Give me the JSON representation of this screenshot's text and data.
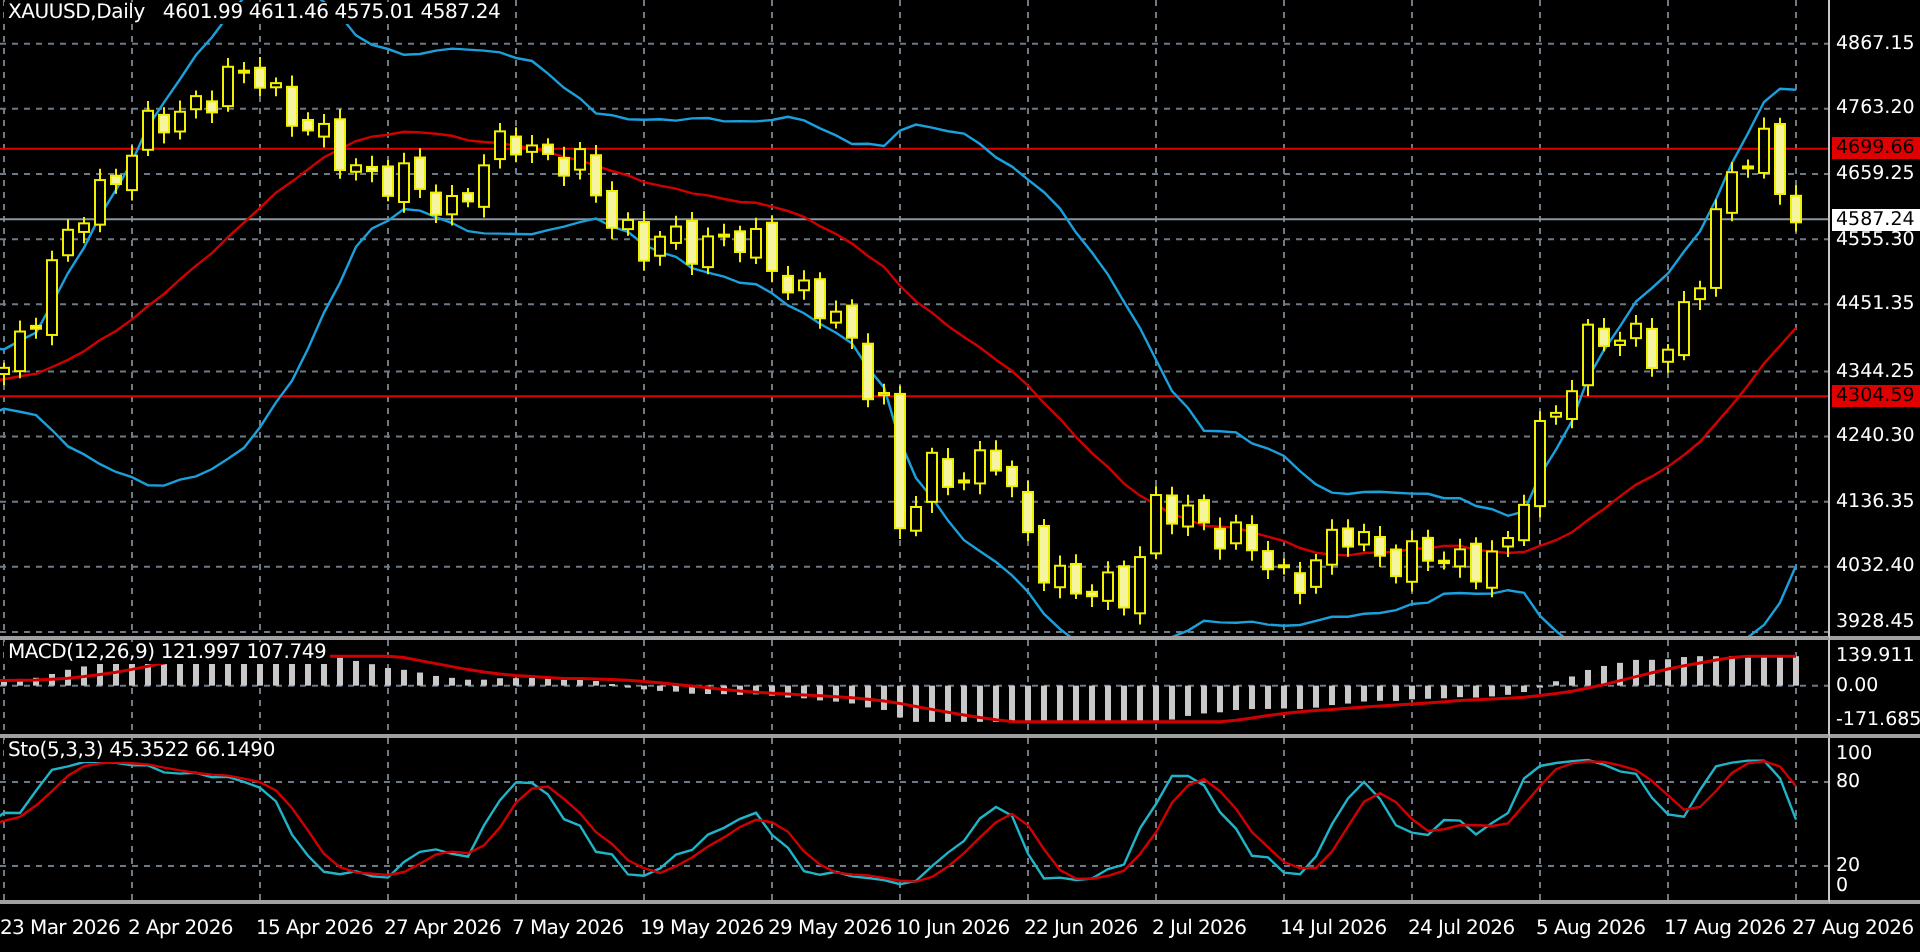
{
  "chart": {
    "symbol": "XAUUSD,Daily",
    "ohlc": "4601.99 4611.46 4575.01 4587.24",
    "price_ticks": [
      "4867.15",
      "4763.20",
      "4659.25",
      "4555.30",
      "4451.35",
      "4344.25",
      "4240.30",
      "4136.35",
      "4032.40",
      "3928.45"
    ],
    "price_lines": [
      {
        "label": "4699.66",
        "kind": "level"
      },
      {
        "label": "4587.24",
        "kind": "bid"
      },
      {
        "label": "4304.59",
        "kind": "level"
      }
    ]
  },
  "macd": {
    "label": "MACD(12,26,9) 121.997 107.749",
    "ticks": [
      "139.911",
      "0.00",
      "-171.685"
    ]
  },
  "stochastic": {
    "label": "Sto(5,3,3) 45.3522 66.1490",
    "ticks": [
      "100",
      "80",
      "20",
      "0"
    ]
  },
  "time_axis": [
    "23 Mar 2026",
    "2 Apr 2026",
    "15 Apr 2026",
    "27 Apr 2026",
    "7 May 2026",
    "19 May 2026",
    "29 May 2026",
    "10 Jun 2026",
    "22 Jun 2026",
    "2 Jul 2026",
    "14 Jul 2026",
    "24 Jul 2026",
    "5 Aug 2026",
    "17 Aug 2026",
    "27 Aug 2026"
  ]
}
